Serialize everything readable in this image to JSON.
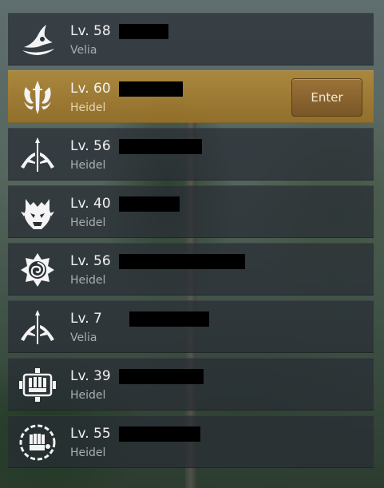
{
  "characters": [
    {
      "level": "Lv. 58",
      "region": "Velia",
      "icon": "witch-hat-icon",
      "redacted": true
    },
    {
      "level": "Lv. 60",
      "region": "Heidel",
      "icon": "sword-crest-icon",
      "redacted": true,
      "selected": true
    },
    {
      "level": "Lv. 56",
      "region": "Heidel",
      "icon": "bow-emblem-icon",
      "redacted": true
    },
    {
      "level": "Lv. 40",
      "region": "Heidel",
      "icon": "demon-mask-icon",
      "redacted": true
    },
    {
      "level": "Lv. 56",
      "region": "Heidel",
      "icon": "rose-emblem-icon",
      "redacted": true
    },
    {
      "level": "Lv. 7",
      "region": "Velia",
      "icon": "bow-emblem-icon",
      "redacted": true
    },
    {
      "level": "Lv. 39",
      "region": "Heidel",
      "icon": "fist-gauntlet-icon",
      "redacted": true
    },
    {
      "level": "Lv. 55",
      "region": "Heidel",
      "icon": "fist-medallion-icon",
      "redacted": true
    }
  ],
  "enter_button": {
    "label": "Enter"
  },
  "colors": {
    "selected_row": "#b08a3a",
    "row_bg": "#282c34",
    "button": "#8a6430",
    "level_text": "#f2f2f2",
    "region_text": "#a9adb4"
  }
}
